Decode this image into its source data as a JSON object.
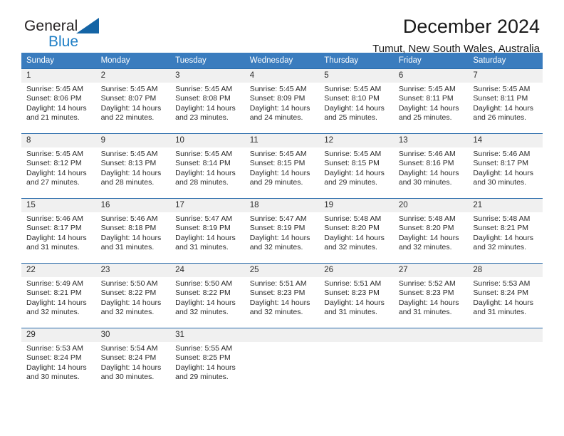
{
  "brand": {
    "line1": "General",
    "line2": "Blue",
    "logo_icon": "triangle-logo-icon"
  },
  "header": {
    "title": "December 2024",
    "subtitle": "Tumut, New South Wales, Australia"
  },
  "calendar": {
    "weekday_headers": [
      "Sunday",
      "Monday",
      "Tuesday",
      "Wednesday",
      "Thursday",
      "Friday",
      "Saturday"
    ],
    "accent_header_color": "#3a7cbe",
    "row_separator_color": "#2b6cab",
    "daynum_band_color": "#f0f0f0",
    "weeks": [
      [
        {
          "day": "1",
          "sunrise": "Sunrise: 5:45 AM",
          "sunset": "Sunset: 8:06 PM",
          "daylight1": "Daylight: 14 hours",
          "daylight2": "and 21 minutes."
        },
        {
          "day": "2",
          "sunrise": "Sunrise: 5:45 AM",
          "sunset": "Sunset: 8:07 PM",
          "daylight1": "Daylight: 14 hours",
          "daylight2": "and 22 minutes."
        },
        {
          "day": "3",
          "sunrise": "Sunrise: 5:45 AM",
          "sunset": "Sunset: 8:08 PM",
          "daylight1": "Daylight: 14 hours",
          "daylight2": "and 23 minutes."
        },
        {
          "day": "4",
          "sunrise": "Sunrise: 5:45 AM",
          "sunset": "Sunset: 8:09 PM",
          "daylight1": "Daylight: 14 hours",
          "daylight2": "and 24 minutes."
        },
        {
          "day": "5",
          "sunrise": "Sunrise: 5:45 AM",
          "sunset": "Sunset: 8:10 PM",
          "daylight1": "Daylight: 14 hours",
          "daylight2": "and 25 minutes."
        },
        {
          "day": "6",
          "sunrise": "Sunrise: 5:45 AM",
          "sunset": "Sunset: 8:11 PM",
          "daylight1": "Daylight: 14 hours",
          "daylight2": "and 25 minutes."
        },
        {
          "day": "7",
          "sunrise": "Sunrise: 5:45 AM",
          "sunset": "Sunset: 8:11 PM",
          "daylight1": "Daylight: 14 hours",
          "daylight2": "and 26 minutes."
        }
      ],
      [
        {
          "day": "8",
          "sunrise": "Sunrise: 5:45 AM",
          "sunset": "Sunset: 8:12 PM",
          "daylight1": "Daylight: 14 hours",
          "daylight2": "and 27 minutes."
        },
        {
          "day": "9",
          "sunrise": "Sunrise: 5:45 AM",
          "sunset": "Sunset: 8:13 PM",
          "daylight1": "Daylight: 14 hours",
          "daylight2": "and 28 minutes."
        },
        {
          "day": "10",
          "sunrise": "Sunrise: 5:45 AM",
          "sunset": "Sunset: 8:14 PM",
          "daylight1": "Daylight: 14 hours",
          "daylight2": "and 28 minutes."
        },
        {
          "day": "11",
          "sunrise": "Sunrise: 5:45 AM",
          "sunset": "Sunset: 8:15 PM",
          "daylight1": "Daylight: 14 hours",
          "daylight2": "and 29 minutes."
        },
        {
          "day": "12",
          "sunrise": "Sunrise: 5:45 AM",
          "sunset": "Sunset: 8:15 PM",
          "daylight1": "Daylight: 14 hours",
          "daylight2": "and 29 minutes."
        },
        {
          "day": "13",
          "sunrise": "Sunrise: 5:46 AM",
          "sunset": "Sunset: 8:16 PM",
          "daylight1": "Daylight: 14 hours",
          "daylight2": "and 30 minutes."
        },
        {
          "day": "14",
          "sunrise": "Sunrise: 5:46 AM",
          "sunset": "Sunset: 8:17 PM",
          "daylight1": "Daylight: 14 hours",
          "daylight2": "and 30 minutes."
        }
      ],
      [
        {
          "day": "15",
          "sunrise": "Sunrise: 5:46 AM",
          "sunset": "Sunset: 8:17 PM",
          "daylight1": "Daylight: 14 hours",
          "daylight2": "and 31 minutes."
        },
        {
          "day": "16",
          "sunrise": "Sunrise: 5:46 AM",
          "sunset": "Sunset: 8:18 PM",
          "daylight1": "Daylight: 14 hours",
          "daylight2": "and 31 minutes."
        },
        {
          "day": "17",
          "sunrise": "Sunrise: 5:47 AM",
          "sunset": "Sunset: 8:19 PM",
          "daylight1": "Daylight: 14 hours",
          "daylight2": "and 31 minutes."
        },
        {
          "day": "18",
          "sunrise": "Sunrise: 5:47 AM",
          "sunset": "Sunset: 8:19 PM",
          "daylight1": "Daylight: 14 hours",
          "daylight2": "and 32 minutes."
        },
        {
          "day": "19",
          "sunrise": "Sunrise: 5:48 AM",
          "sunset": "Sunset: 8:20 PM",
          "daylight1": "Daylight: 14 hours",
          "daylight2": "and 32 minutes."
        },
        {
          "day": "20",
          "sunrise": "Sunrise: 5:48 AM",
          "sunset": "Sunset: 8:20 PM",
          "daylight1": "Daylight: 14 hours",
          "daylight2": "and 32 minutes."
        },
        {
          "day": "21",
          "sunrise": "Sunrise: 5:48 AM",
          "sunset": "Sunset: 8:21 PM",
          "daylight1": "Daylight: 14 hours",
          "daylight2": "and 32 minutes."
        }
      ],
      [
        {
          "day": "22",
          "sunrise": "Sunrise: 5:49 AM",
          "sunset": "Sunset: 8:21 PM",
          "daylight1": "Daylight: 14 hours",
          "daylight2": "and 32 minutes."
        },
        {
          "day": "23",
          "sunrise": "Sunrise: 5:50 AM",
          "sunset": "Sunset: 8:22 PM",
          "daylight1": "Daylight: 14 hours",
          "daylight2": "and 32 minutes."
        },
        {
          "day": "24",
          "sunrise": "Sunrise: 5:50 AM",
          "sunset": "Sunset: 8:22 PM",
          "daylight1": "Daylight: 14 hours",
          "daylight2": "and 32 minutes."
        },
        {
          "day": "25",
          "sunrise": "Sunrise: 5:51 AM",
          "sunset": "Sunset: 8:23 PM",
          "daylight1": "Daylight: 14 hours",
          "daylight2": "and 32 minutes."
        },
        {
          "day": "26",
          "sunrise": "Sunrise: 5:51 AM",
          "sunset": "Sunset: 8:23 PM",
          "daylight1": "Daylight: 14 hours",
          "daylight2": "and 31 minutes."
        },
        {
          "day": "27",
          "sunrise": "Sunrise: 5:52 AM",
          "sunset": "Sunset: 8:23 PM",
          "daylight1": "Daylight: 14 hours",
          "daylight2": "and 31 minutes."
        },
        {
          "day": "28",
          "sunrise": "Sunrise: 5:53 AM",
          "sunset": "Sunset: 8:24 PM",
          "daylight1": "Daylight: 14 hours",
          "daylight2": "and 31 minutes."
        }
      ],
      [
        {
          "day": "29",
          "sunrise": "Sunrise: 5:53 AM",
          "sunset": "Sunset: 8:24 PM",
          "daylight1": "Daylight: 14 hours",
          "daylight2": "and 30 minutes."
        },
        {
          "day": "30",
          "sunrise": "Sunrise: 5:54 AM",
          "sunset": "Sunset: 8:24 PM",
          "daylight1": "Daylight: 14 hours",
          "daylight2": "and 30 minutes."
        },
        {
          "day": "31",
          "sunrise": "Sunrise: 5:55 AM",
          "sunset": "Sunset: 8:25 PM",
          "daylight1": "Daylight: 14 hours",
          "daylight2": "and 29 minutes."
        },
        {
          "day": "",
          "sunrise": "",
          "sunset": "",
          "daylight1": "",
          "daylight2": ""
        },
        {
          "day": "",
          "sunrise": "",
          "sunset": "",
          "daylight1": "",
          "daylight2": ""
        },
        {
          "day": "",
          "sunrise": "",
          "sunset": "",
          "daylight1": "",
          "daylight2": ""
        },
        {
          "day": "",
          "sunrise": "",
          "sunset": "",
          "daylight1": "",
          "daylight2": ""
        }
      ]
    ]
  }
}
